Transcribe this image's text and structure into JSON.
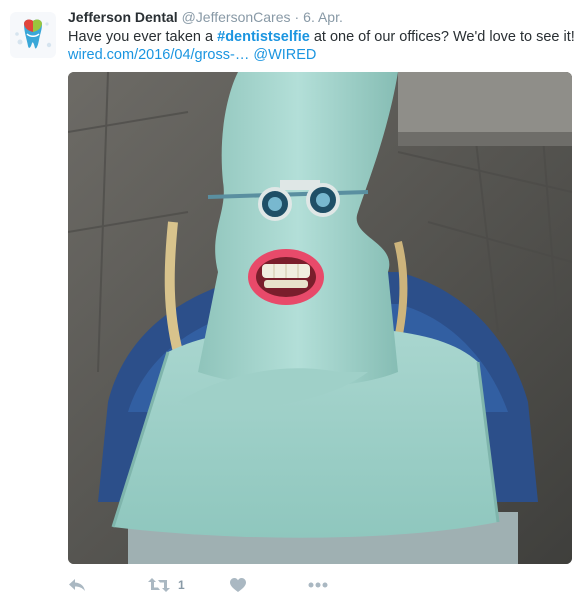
{
  "tweet": {
    "author": {
      "name": "Jefferson Dental",
      "handle": "@JeffersonCares",
      "separator": "·",
      "date": "6. Apr."
    },
    "text_before": "Have you ever taken a ",
    "hashtag": "#dentistselfie",
    "text_after": " at one of our offices? We'd love to see it!",
    "link": "wired.com/2016/04/gross-…",
    "mention": "@WIRED",
    "media_icon": "photo-dentist-selfie",
    "actions": {
      "reply_icon": "reply-icon",
      "retweet_icon": "retweet-icon",
      "retweet_count": "1",
      "like_icon": "heart-icon",
      "more_icon": "more-icon"
    },
    "colors": {
      "accent": "#1b95e0",
      "text": "#292f33",
      "muted": "#8899a6",
      "icon": "#aab8c2"
    }
  }
}
